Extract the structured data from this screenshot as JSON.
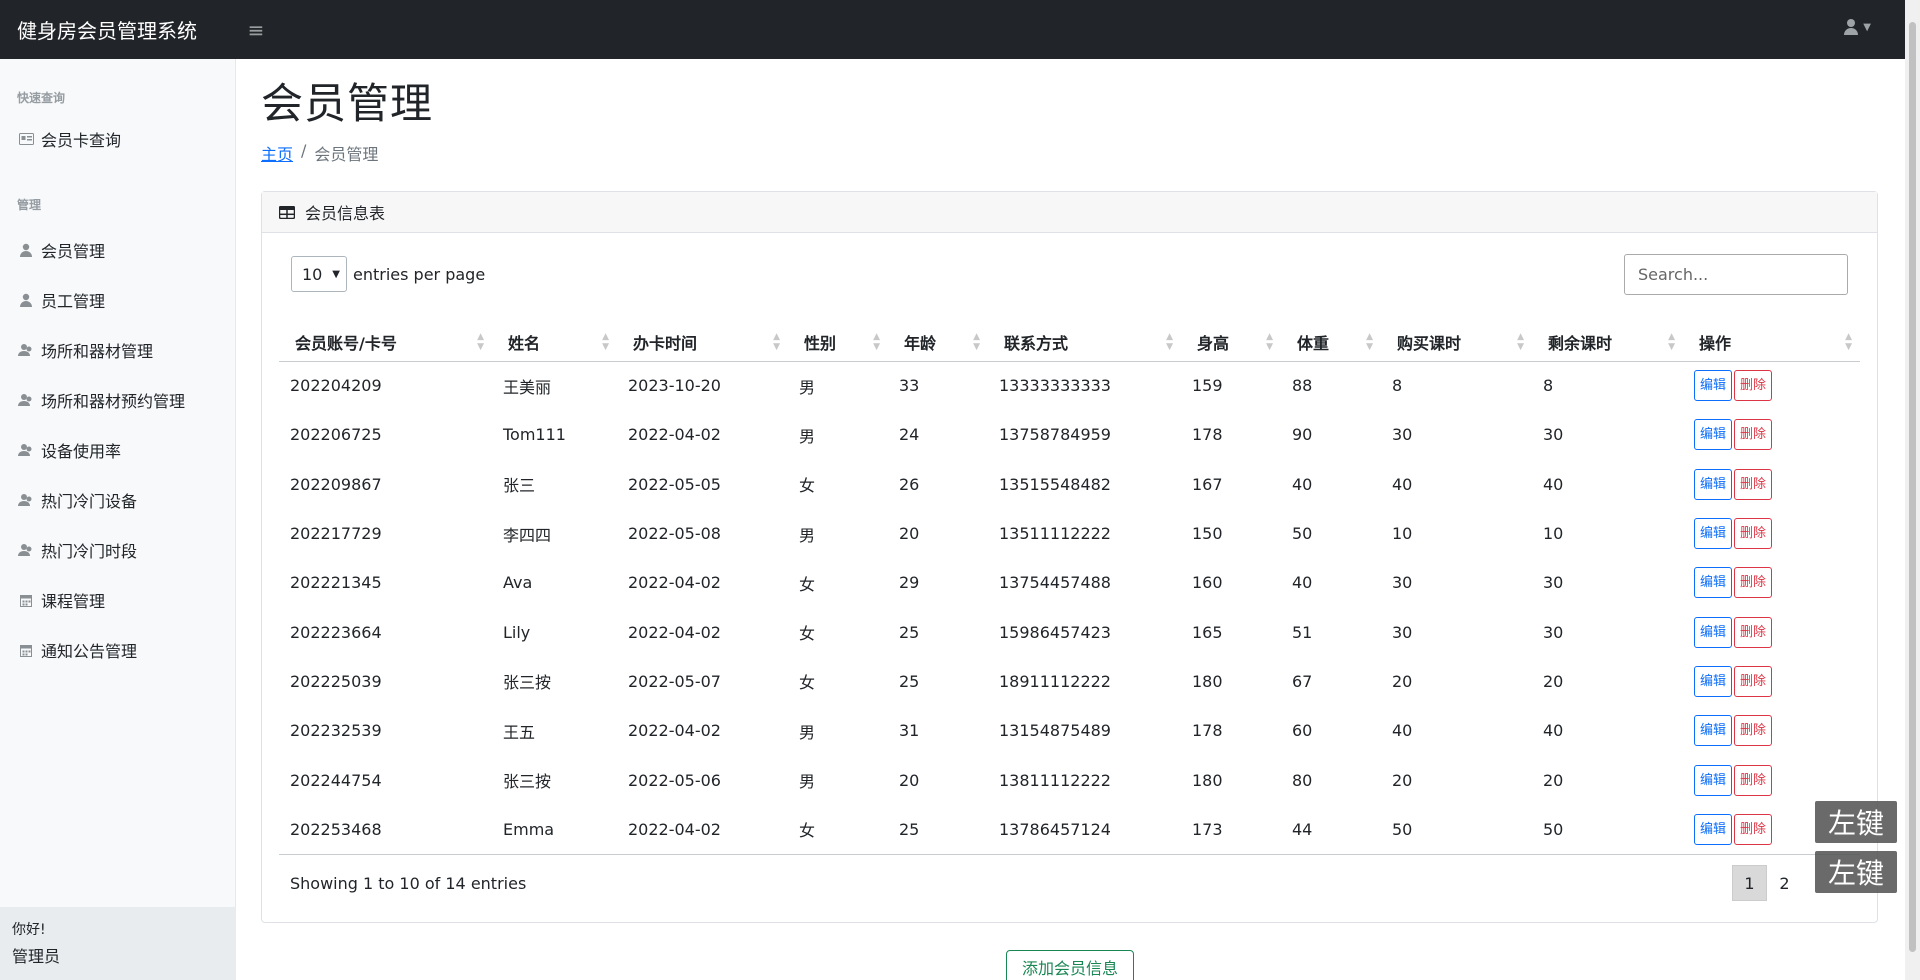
{
  "topbar": {
    "brand": "健身房会员管理系统",
    "toggle_icon": "menu-icon",
    "user_icon": "user-icon"
  },
  "sidebar": {
    "sections": [
      {
        "heading": "快速查询",
        "items": [
          {
            "label": "会员卡查询",
            "icon": "id-card-icon"
          }
        ]
      },
      {
        "heading": "管理",
        "items": [
          {
            "label": "会员管理",
            "icon": "user-icon"
          },
          {
            "label": "员工管理",
            "icon": "user-icon"
          },
          {
            "label": "场所和器材管理",
            "icon": "group-icon"
          },
          {
            "label": "场所和器材预约管理",
            "icon": "group-icon"
          },
          {
            "label": "设备使用率",
            "icon": "group-icon"
          },
          {
            "label": "热门冷门设备",
            "icon": "group-icon"
          },
          {
            "label": "热门冷门时段",
            "icon": "group-icon"
          },
          {
            "label": "课程管理",
            "icon": "calendar-icon"
          },
          {
            "label": "通知公告管理",
            "icon": "calendar-icon"
          }
        ]
      }
    ],
    "footer": {
      "greeting": "你好!",
      "username": "管理员"
    }
  },
  "main": {
    "title": "会员管理",
    "breadcrumb": {
      "home": "主页",
      "separator": "/",
      "current": "会员管理"
    },
    "card_title": "会员信息表",
    "per_page_value": "10",
    "per_page_label": "entries per page",
    "search_placeholder": "Search...",
    "columns": [
      "会员账号/卡号",
      "姓名",
      "办卡时间",
      "性别",
      "年龄",
      "联系方式",
      "身高",
      "体重",
      "购买课时",
      "剩余课时",
      "操作"
    ],
    "rows": [
      [
        "202204209",
        "王美丽",
        "2023-10-20",
        "男",
        "33",
        "13333333333",
        "159",
        "88",
        "8",
        "8"
      ],
      [
        "202206725",
        "Tom111",
        "2022-04-02",
        "男",
        "24",
        "13758784959",
        "178",
        "90",
        "30",
        "30"
      ],
      [
        "202209867",
        "张三",
        "2022-05-05",
        "女",
        "26",
        "13515548482",
        "167",
        "40",
        "40",
        "40"
      ],
      [
        "202217729",
        "李四四",
        "2022-05-08",
        "男",
        "20",
        "13511112222",
        "150",
        "50",
        "10",
        "10"
      ],
      [
        "202221345",
        "Ava",
        "2022-04-02",
        "女",
        "29",
        "13754457488",
        "160",
        "40",
        "30",
        "30"
      ],
      [
        "202223664",
        "Lily",
        "2022-04-02",
        "女",
        "25",
        "15986457423",
        "165",
        "51",
        "30",
        "30"
      ],
      [
        "202225039",
        "张三按",
        "2022-05-07",
        "女",
        "25",
        "18911112222",
        "180",
        "67",
        "20",
        "20"
      ],
      [
        "202232539",
        "王五",
        "2022-04-02",
        "男",
        "31",
        "13154875489",
        "178",
        "60",
        "40",
        "40"
      ],
      [
        "202244754",
        "张三按",
        "2022-05-06",
        "男",
        "20",
        "13811112222",
        "180",
        "80",
        "20",
        "20"
      ],
      [
        "202253468",
        "Emma",
        "2022-04-02",
        "女",
        "25",
        "13786457124",
        "173",
        "44",
        "50",
        "50"
      ]
    ],
    "edit_label": "编辑",
    "delete_label": "删除",
    "showing_text": "Showing 1 to 10 of 14 entries",
    "pages": [
      "1",
      "2"
    ],
    "add_button": "添加会员信息"
  },
  "overlay_keys": [
    "左键",
    "左键"
  ]
}
